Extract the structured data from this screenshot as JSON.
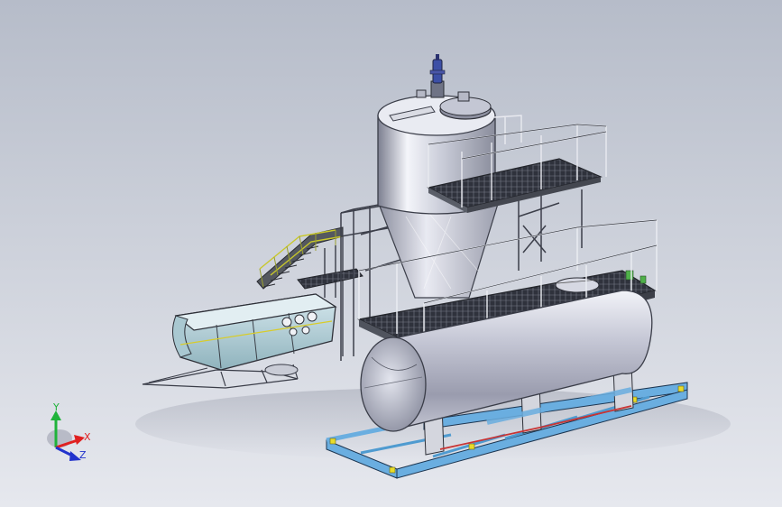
{
  "viewport": {
    "background_top": "#b6bcc9",
    "background_bottom": "#e6e8ee"
  },
  "triad": {
    "y_label": "Y",
    "x_label": "X",
    "z_label": "Z",
    "y_color": "#1fb33a",
    "x_color": "#e02020",
    "z_color": "#2233cc"
  },
  "colors": {
    "metal_light": "#eef0f6",
    "metal_mid": "#b9bccb",
    "metal_dark": "#6c6f80",
    "grating": "#2c2f38",
    "skid_blue": "#6aaee0",
    "skid_yellow": "#e8dc2a",
    "motor_blue": "#3c4fa6",
    "trough_cyan": "#b7d7df",
    "red_band": "#c83434",
    "green_accent": "#4fb04a"
  },
  "components": [
    "vertical-tank",
    "agitator-motor",
    "upper-platform",
    "lower-platform",
    "access-stair",
    "horizontal-tank",
    "base-skid",
    "trough-hopper"
  ]
}
